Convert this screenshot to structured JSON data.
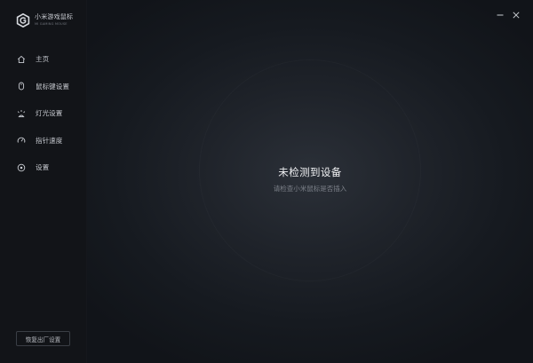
{
  "brand": {
    "name": "小米游戏鼠标",
    "subtitle": "MI GAMING MOUSE"
  },
  "nav": {
    "items": [
      {
        "label": "主页",
        "icon": "home-icon"
      },
      {
        "label": "鼠标键设置",
        "icon": "mouse-icon"
      },
      {
        "label": "灯光设置",
        "icon": "light-icon"
      },
      {
        "label": "指针速度",
        "icon": "speedometer-icon"
      },
      {
        "label": "设置",
        "icon": "settings-icon"
      }
    ]
  },
  "footer": {
    "reset_label": "恢复出厂设置"
  },
  "status": {
    "title": "未检测到设备",
    "subtitle": "请检查小米鼠标是否插入"
  },
  "window": {
    "minimize_icon": "minimize-icon",
    "close_icon": "close-icon"
  },
  "colors": {
    "accent_text": "#f0f1f3",
    "muted_text": "#7c8089",
    "sidebar_bg": "#121418"
  }
}
